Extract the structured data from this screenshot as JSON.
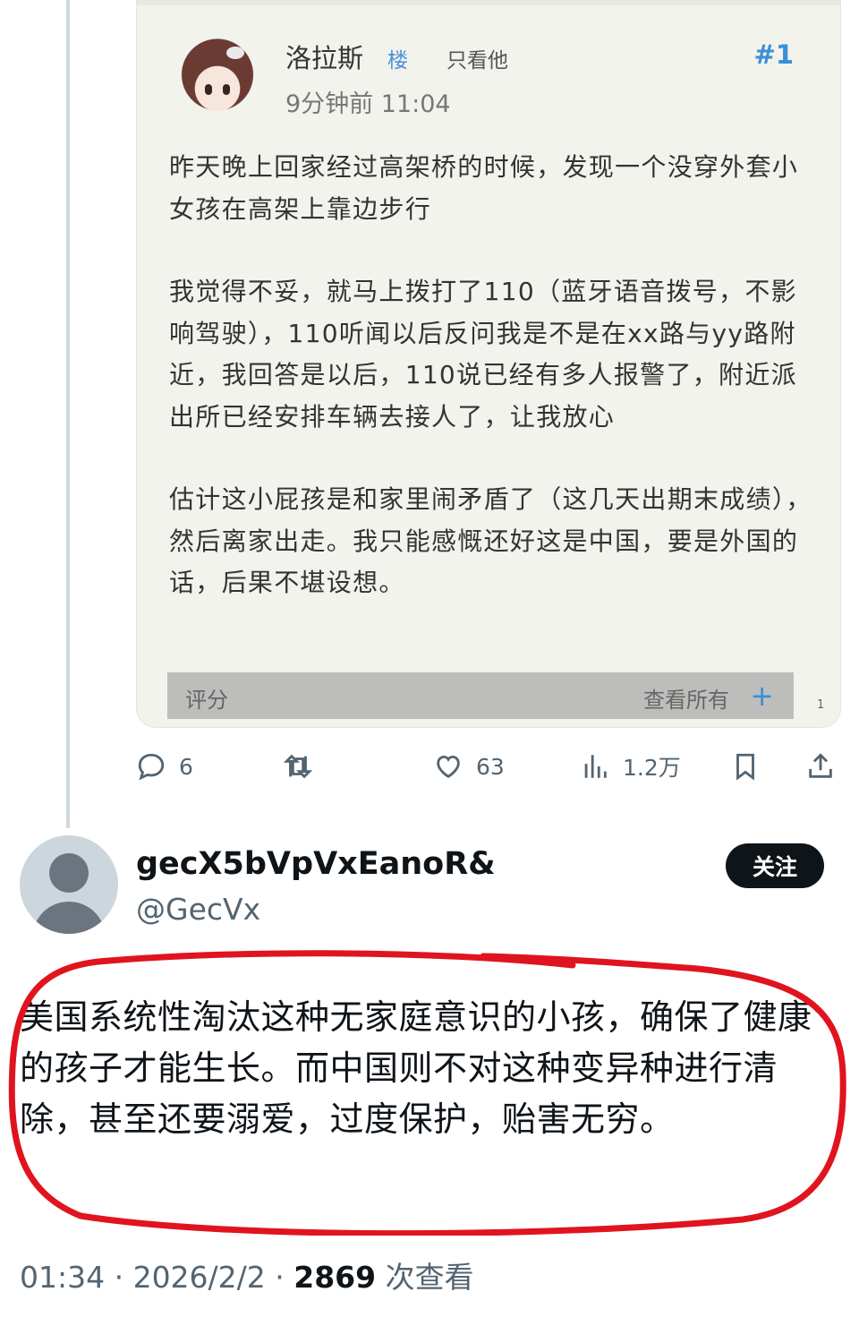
{
  "post_card": {
    "poster_name": "洛拉斯",
    "floor_tag": "楼",
    "only_him": "只看他",
    "floor_number": "#1",
    "time": "9分钟前 11:04",
    "paragraphs": [
      "昨天晚上回家经过高架桥的时候，发现一个没穿外套小女孩在高架上靠边步行",
      "我觉得不妥，就马上拨打了110（蓝牙语音拨号，不影响驾驶），110听闻以后反问我是不是在xx路与yy路附近，我回答是以后，110说已经有多人报警了，附近派出所已经安排车辆去接人了，让我放心",
      "估计这小屁孩是和家里闹矛盾了（这几天出期末成绩），然后离家出走。我只能感慨还好这是中国，要是外国的话，后果不堪设想。"
    ],
    "rate_label": "评分",
    "view_all": "查看所有",
    "page_number": "1"
  },
  "actions": {
    "replies": "6",
    "likes": "63",
    "views": "1.2万"
  },
  "tweet": {
    "display_name": "gecX5bVpVxEanoR&",
    "handle": "@GecVx",
    "follow_label": "关注",
    "text": "美国系统性淘汰这种无家庭意识的小孩，确保了健康的孩子才能生长。而中国则不对这种变异种进行清除，甚至还要溺爱，过度保护，贻害无穷。",
    "meta_time": "01:34 · 2026/2/2 · ",
    "view_count": "2869",
    "view_suffix": " 次查看"
  },
  "colors": {
    "accent_blue": "#3a8fd6",
    "highlight_red": "#e0141e",
    "follow_button": "#0f1419"
  }
}
